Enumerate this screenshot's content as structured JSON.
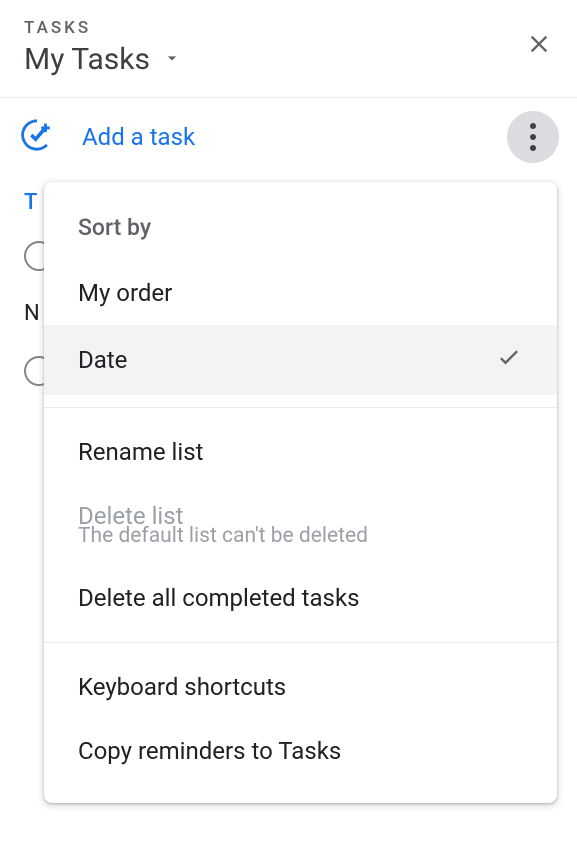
{
  "header": {
    "label": "TASKS",
    "list_name": "My Tasks"
  },
  "toolbar": {
    "add_task_label": "Add a task"
  },
  "background": {
    "section_header": "T",
    "task_text_partial": "N"
  },
  "menu": {
    "sort_header": "Sort by",
    "items": {
      "my_order": "My order",
      "date": "Date",
      "rename_list": "Rename list",
      "delete_list": "Delete list",
      "delete_list_subtitle": "The default list can't be deleted",
      "delete_completed": "Delete all completed tasks",
      "keyboard_shortcuts": "Keyboard shortcuts",
      "copy_reminders": "Copy reminders to Tasks"
    }
  }
}
